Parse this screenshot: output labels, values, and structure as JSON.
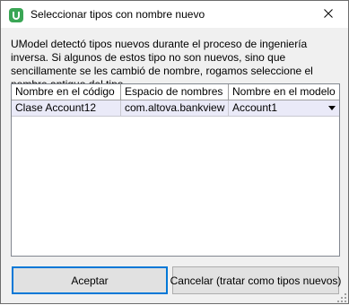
{
  "window": {
    "title": "Seleccionar tipos con nombre nuevo"
  },
  "message": "UModel detectó tipos nuevos durante el proceso de ingeniería inversa. Si algunos de estos tipo no son nuevos, sino que sencillamente se les cambió de nombre, rogamos seleccione el nombre antiguo del tipo.",
  "table": {
    "columns": [
      "Nombre en el código",
      "Espacio de nombres",
      "Nombre en el modelo"
    ],
    "rows": [
      [
        "Clase Account12",
        "com.altova.bankview",
        "Account1"
      ]
    ]
  },
  "buttons": {
    "accept": "Aceptar",
    "cancel": "Cancelar (tratar como tipos nuevos)"
  },
  "colors": {
    "accent": "#0078d7",
    "row_selected": "#eaeaf8",
    "icon_green": "#3aa655"
  },
  "icons": {
    "app": "umodel-app-icon",
    "close": "close-icon",
    "dropdown": "chevron-down-icon",
    "grip": "resize-grip-icon"
  }
}
